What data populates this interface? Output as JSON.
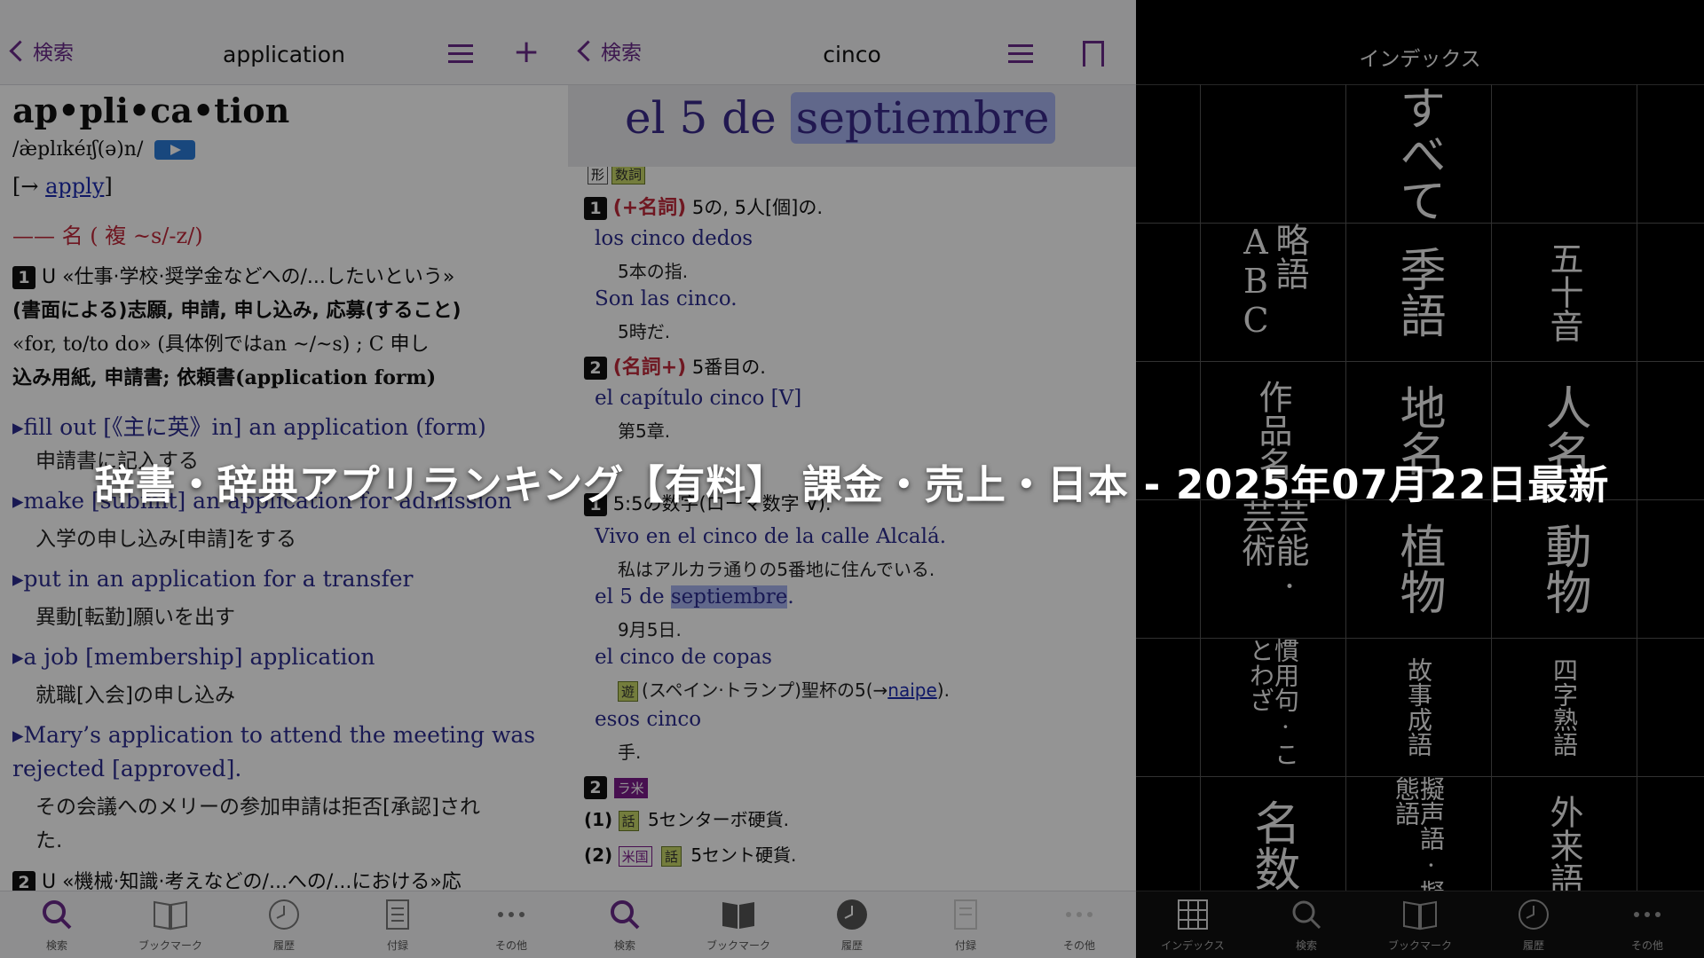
{
  "panel_left": {
    "nav": {
      "back": "検索",
      "title": "application"
    },
    "headword": "ap•pli•ca•tion",
    "pron": "/æ̀plɪkéɪʃ(ə)n/",
    "ref": {
      "arrow": "[→ ",
      "word": "apply",
      "close": "]"
    },
    "pos_line": "—— 名 ( 複 ~s/-z/)",
    "sense1": [
      "U «仕事·学校·奨学金などへの/...したいという»",
      "(書面による)志願, 申請, 申し込み, 応募(すること)",
      "«for, to/to do» (具体例ではan ~/~s) ; C 申し",
      "込み用紙, 申請書; 依頼書(application form)"
    ],
    "examples": [
      {
        "en": "▸fill out [《主に英》in] an application (form)",
        "ja": "申請書に記入する"
      },
      {
        "en": "▸make [submit] an application for admission",
        "ja": "入学の申し込み[申請]をする"
      },
      {
        "en": "▸put in an application for a transfer",
        "ja": "異動[転勤]願いを出す"
      },
      {
        "en": "▸a job [membership] application",
        "ja": "就職[入会]の申し込み"
      },
      {
        "en": "▸Mary’s application to attend the meeting was",
        "en2": "rejected [approved].",
        "ja": "その会議へのメリーの参加申請は拒否[承認]され",
        "ja2": "た."
      }
    ],
    "sense2": "U «機械·知識·考えなどの/...への/...における»応",
    "num1": "1",
    "num2": "2"
  },
  "panel_middle": {
    "nav": {
      "back": "検索",
      "title": "cinco"
    },
    "highlight": {
      "pre": "el 5 de ",
      "mark": "septiembre"
    },
    "tags_top": [
      "形",
      "数詞"
    ],
    "sense1": {
      "num": "1",
      "pos": "(+名詞)",
      "def": "5の, 5人[個]の."
    },
    "ex1": [
      {
        "es": "los cinco dedos",
        "ja": "5本の指."
      },
      {
        "es": "Son las cinco.",
        "ja": "5時だ."
      }
    ],
    "sense2": {
      "num": "2",
      "pos": "(名詞+)",
      "def": "5番目の."
    },
    "ex2": [
      {
        "es": "el capítulo cinco [V]",
        "ja": "第5章."
      }
    ],
    "sense3": {
      "num": "1",
      "def": "5:5の数字(ローマ数字 V)."
    },
    "ex3": [
      {
        "es": "Vivo en el cinco de la calle Alcalá.",
        "ja": "私はアルカラ通りの5番地に住んでいる."
      },
      {
        "es_pre": "el 5 de ",
        "es_mark": "septiembre",
        "es_post": ".",
        "ja": "9月5日."
      },
      {
        "es": "el cinco de copas",
        "tag": "遊",
        "ja_pre": "(スペイン·トランプ)聖杯の5(→",
        "ja_link": "naipe",
        "ja_post": ")."
      },
      {
        "es": "esos cinco",
        "ja": "手."
      }
    ],
    "sense4": {
      "num": "2",
      "tag": "ラ米"
    },
    "sub1": {
      "label": "(1)",
      "tag": "話",
      "def": "5センターボ硬貨."
    },
    "sub2": {
      "label": "(2)",
      "tag1": "米国",
      "tag2": "話",
      "def": "5セント硬貨."
    }
  },
  "panel_right": {
    "nav": {
      "title": "インデックス"
    },
    "cells": [
      {
        "text": "すべて",
        "size": "large"
      },
      {
        "text": "略語ABC",
        "size": "small"
      },
      {
        "text": "季語",
        "size": "large"
      },
      {
        "text": "五十音",
        "size": "small"
      },
      {
        "text": "作品名",
        "size": "small"
      },
      {
        "text": "地名",
        "size": "large"
      },
      {
        "text": "人名",
        "size": "large"
      },
      {
        "text": "芸能·芸術",
        "size": "small"
      },
      {
        "text": "植物",
        "size": "large"
      },
      {
        "text": "動物",
        "size": "large"
      },
      {
        "text": "慣用句·ことわざ",
        "size": "tiny"
      },
      {
        "text": "故事成語",
        "size": "tiny"
      },
      {
        "text": "四字熟語",
        "size": "tiny"
      },
      {
        "text": "名数",
        "size": "large"
      },
      {
        "text": "擬声語·擬態語",
        "size": "tiny"
      },
      {
        "text": "外来語",
        "size": "small"
      }
    ]
  },
  "tabs_left": [
    "検索",
    "ブックマーク",
    "履歴",
    "付録",
    "その他"
  ],
  "tabs_middle": [
    "検索",
    "ブックマーク",
    "履歴",
    "付録",
    "その他"
  ],
  "tabs_right": [
    "インデックス",
    "検索",
    "ブックマーク",
    "履歴",
    "その他"
  ],
  "headline": "辞書・辞典アプリランキング【有料】 課金・売上・日本 - 2025年07月22日最新",
  "colors": {
    "accent": "#6a2a8a",
    "example": "#2b2c8f",
    "pos_red": "#c0283a",
    "highlight": "#a8b4f0"
  }
}
